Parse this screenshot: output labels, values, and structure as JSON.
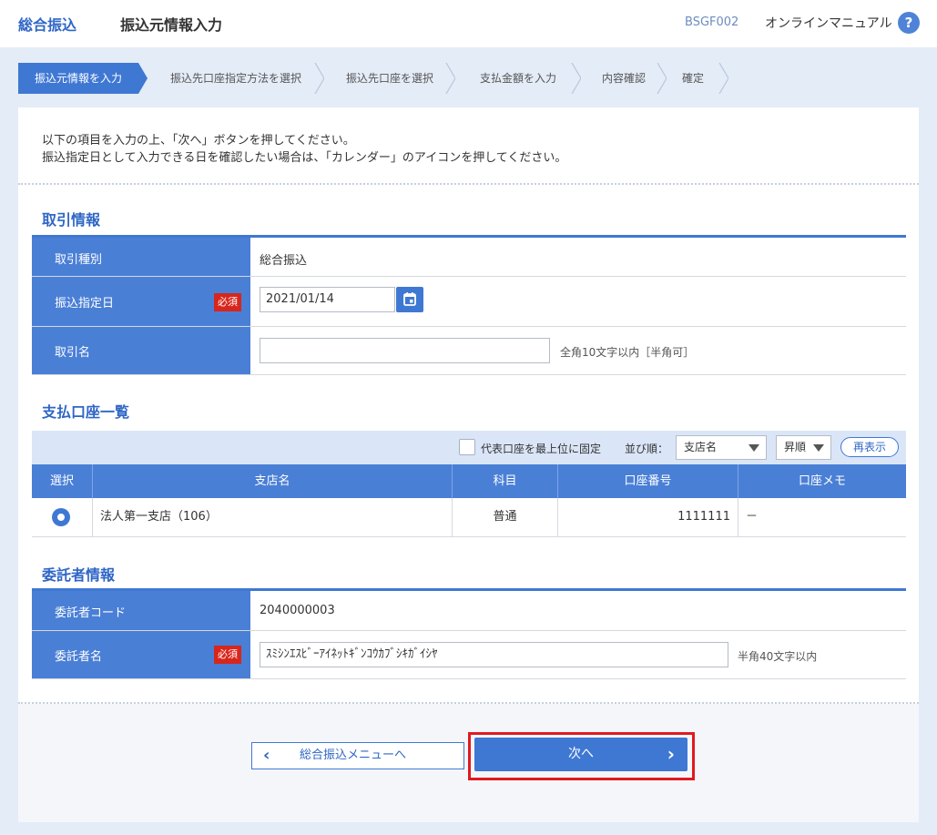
{
  "header": {
    "service": "総合振込",
    "title": "振込元情報入力",
    "screen_code": "BSGF002",
    "manual": "オンラインマニュアル",
    "help": "?"
  },
  "steps": [
    {
      "label": "振込元情報を入力",
      "active": true
    },
    {
      "label": "振込先口座指定方法を選択",
      "active": false
    },
    {
      "label": "振込先口座を選択",
      "active": false
    },
    {
      "label": "支払金額を入力",
      "active": false
    },
    {
      "label": "内容確認",
      "active": false
    },
    {
      "label": "確定",
      "active": false
    }
  ],
  "intro": {
    "line1": "以下の項目を入力の上、「次へ」ボタンを押してください。",
    "line2": "振込指定日として入力できる日を確認したい場合は、「カレンダー」のアイコンを押してください。"
  },
  "transaction": {
    "title": "取引情報",
    "type_label": "取引種別",
    "type_value": "総合振込",
    "date_label": "振込指定日",
    "required": "必須",
    "date_value": "2021/01/14",
    "name_label": "取引名",
    "name_value": "",
    "name_hint": "全角10文字以内［半角可］"
  },
  "accounts": {
    "title": "支払口座一覧",
    "pin_label": "代表口座を最上位に固定",
    "sort_label": "並び順：",
    "sort_value": "支店名",
    "order_value": "昇順",
    "redisplay": "再表示",
    "columns": [
      "選択",
      "支店名",
      "科目",
      "口座番号",
      "口座メモ"
    ],
    "rows": [
      {
        "branch": "法人第一支店（106）",
        "subject": "普通",
        "number": "1111111",
        "memo": "－"
      }
    ]
  },
  "consignor": {
    "title": "委託者情報",
    "code_label": "委託者コード",
    "code_value": "2040000003",
    "name_label": "委託者名",
    "required": "必須",
    "name_value": "ｽﾐｼﾝｴｽﾋﾞｰｱｲﾈｯﾄｷﾞﾝｺｳｶﾌﾞｼｷｶﾞｲｼﾔ",
    "name_hint": "半角40文字以内"
  },
  "footer": {
    "back_label": "総合振込メニューへ",
    "next_label": "次へ"
  },
  "colors": {
    "primary": "#3f78d3",
    "header_text": "#2f66c6",
    "required": "#d8261c",
    "highlight": "#e01a1f"
  }
}
